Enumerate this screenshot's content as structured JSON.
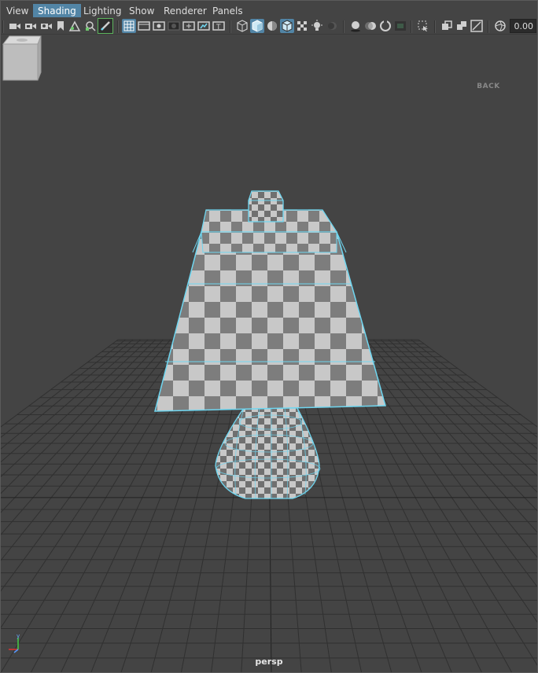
{
  "menu": {
    "items": [
      {
        "label": "View",
        "active": false
      },
      {
        "label": "Shading",
        "active": true
      },
      {
        "label": "Lighting",
        "active": false
      },
      {
        "label": "Show",
        "active": false
      },
      {
        "label": "Renderer",
        "active": false
      },
      {
        "label": "Panels",
        "active": false
      }
    ]
  },
  "toolbar": {
    "icons": [
      "select-camera-icon",
      "lock-camera-icon",
      "camera-attributes-icon",
      "bookmark-icon",
      "image-plane-icon",
      "2d-pan-zoom-icon",
      "grease-pencil-icon",
      "grid-icon",
      "film-gate-icon",
      "resolution-gate-icon",
      "gate-mask-icon",
      "field-chart-icon",
      "safe-action-icon",
      "safe-title-icon",
      "wireframe-icon",
      "smooth-shade-icon",
      "default-material-icon",
      "wireframe-on-shaded-icon",
      "textured-icon",
      "use-all-lights-icon",
      "shadows-icon",
      "screen-space-ao-icon",
      "motion-blur-icon",
      "anti-aliasing-icon",
      "depth-of-field-icon",
      "isolate-select-icon",
      "xray-icon",
      "xray-joints-icon",
      "xray-active-icon",
      "backface-culling-icon",
      "exposure-icon"
    ],
    "zoom_value": "0.00"
  },
  "viewport": {
    "camera_label": "persp",
    "viewcube_face": "BACK",
    "accent_color": "#6fd6f0",
    "grid_color": "#2f2f2f",
    "background": "#444444"
  }
}
